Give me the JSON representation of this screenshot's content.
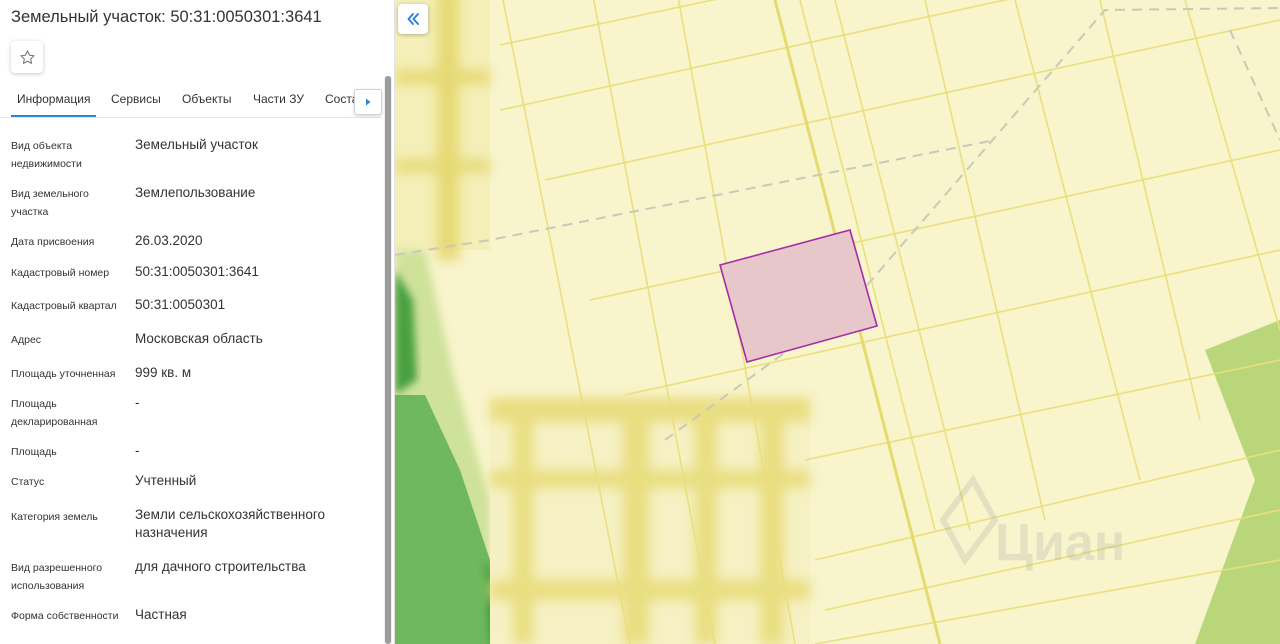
{
  "header": {
    "title": "Земельный участок: 50:31:0050301:3641"
  },
  "favorite": {
    "icon": "star-outline-icon"
  },
  "tabs": [
    {
      "label": "Информация",
      "active": true
    },
    {
      "label": "Сервисы",
      "active": false
    },
    {
      "label": "Объекты",
      "active": false
    },
    {
      "label": "Части ЗУ",
      "active": false
    },
    {
      "label": "Состав",
      "active": false
    }
  ],
  "tab_scroll_icon": "chevron-right-icon",
  "details": [
    {
      "label": "Вид объекта недвижимости",
      "value": "Земельный участок"
    },
    {
      "label": "Вид земельного участка",
      "value": "Землепользование"
    },
    {
      "label": "Дата присвоения",
      "value": "26.03.2020"
    },
    {
      "label": "Кадастровый номер",
      "value": "50:31:0050301:3641"
    },
    {
      "label": "Кадастровый квартал",
      "value": "50:31:0050301"
    },
    {
      "label": "Адрес",
      "value": "Московская область"
    },
    {
      "label": "Площадь уточненная",
      "value": "999 кв. м"
    },
    {
      "label": "Площадь декларированная",
      "value": "-"
    },
    {
      "label": "Площадь",
      "value": "-"
    },
    {
      "label": "Статус",
      "value": "Учтенный"
    },
    {
      "label": "Категория земель",
      "value": "Земли сельскохозяйственного назначения"
    },
    {
      "label": "Вид разрешенного использования",
      "value": "для дачного строительства"
    },
    {
      "label": "Форма собственности",
      "value": "Частная"
    }
  ],
  "map": {
    "collapse_icon": "double-chevron-left-icon",
    "watermark": "Циан",
    "colors": {
      "background": "#f8f4cc",
      "parcel_line": "#eadf7c",
      "parcel_fill": "#e7c7c9",
      "parcel_stroke": "#a52ca8",
      "forest": "#6fb85e",
      "light_green": "#b9d77a",
      "dashed": "#c9c9b8"
    }
  }
}
